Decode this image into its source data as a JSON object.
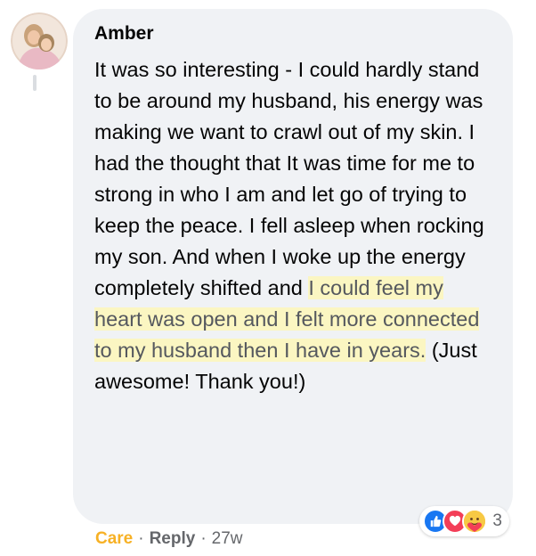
{
  "comment": {
    "author": "Amber",
    "text_parts": [
      "It was so interesting - I could hardly stand to be around my husband, his energy was making we want to crawl out of my skin. I had the thought that It was time for me to strong in who I am and let go of trying to keep the peace. I fell asleep when rocking my son. And when I woke up the energy completely shifted and ",
      "I could feel my heart was open and I felt more connected to my husband then I have in years.",
      " (Just awesome! Thank you!)"
    ],
    "reactions": {
      "icons": [
        "like-icon",
        "love-icon",
        "care-icon"
      ],
      "count": "3"
    },
    "actions": {
      "care_label": "Care",
      "separator": "·",
      "reply_label": "Reply",
      "time": "27w"
    }
  },
  "colors": {
    "bubble": "#f0f2f5",
    "highlight": "#fbf6c2",
    "care": "#f7b125",
    "like": "#1877f2",
    "love": "#f33e58",
    "muted": "#65676b"
  }
}
